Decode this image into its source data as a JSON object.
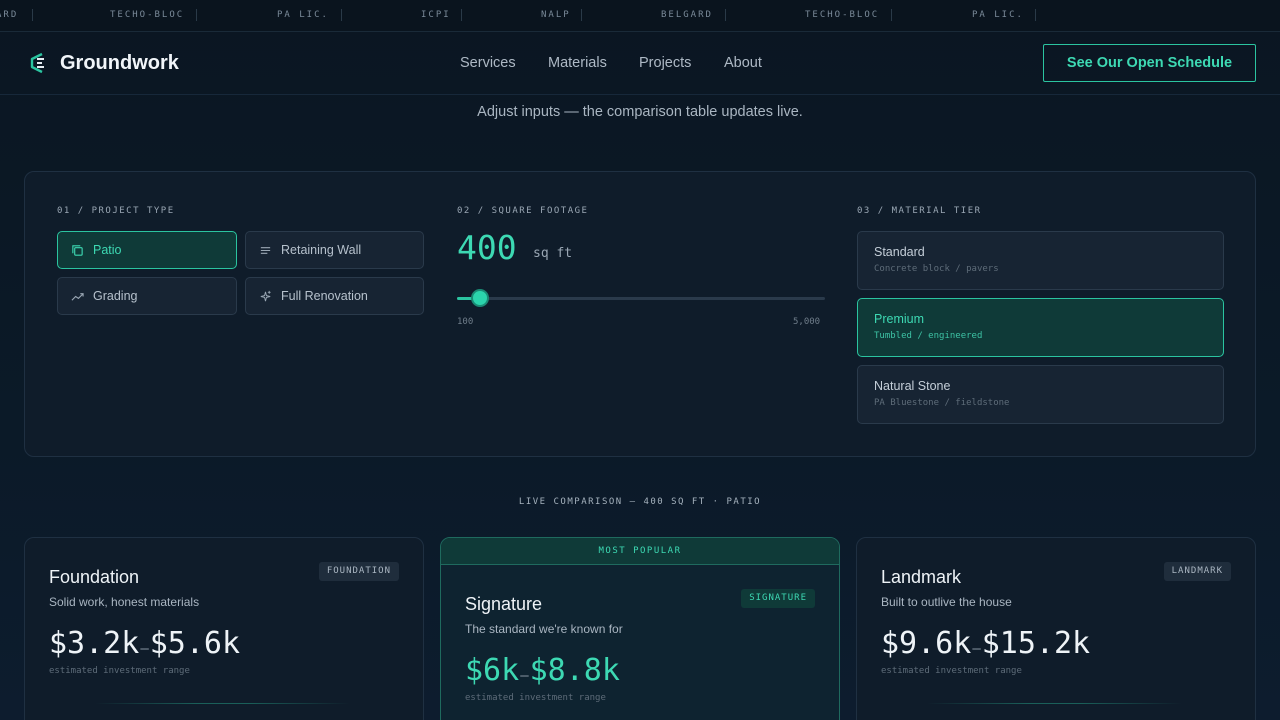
{
  "ticker": [
    "ARD",
    "TECHO-BLOC",
    "PA LIC.",
    "ICPI",
    "NALP",
    "BELGARD",
    "TECHO-BLOC",
    "PA LIC."
  ],
  "brand": {
    "name": "Groundwork",
    "icon": "groundwork-logo-icon"
  },
  "nav": [
    "Services",
    "Materials",
    "Projects",
    "About"
  ],
  "cta_label": "See Our Open Schedule",
  "subtitle": "Adjust inputs — the comparison table updates live.",
  "config": {
    "project_type": {
      "label": "01 / PROJECT TYPE",
      "options": [
        {
          "label": "Patio",
          "icon": "copy-icon",
          "selected": true
        },
        {
          "label": "Retaining Wall",
          "icon": "lines-icon",
          "selected": false
        },
        {
          "label": "Grading",
          "icon": "trend-icon",
          "selected": false
        },
        {
          "label": "Full Renovation",
          "icon": "sparkle-icon",
          "selected": false
        }
      ]
    },
    "square_footage": {
      "label": "02 / SQUARE FOOTAGE",
      "value": "400",
      "unit": "sq ft",
      "min_label": "100",
      "max_label": "5,000",
      "min": 100,
      "max": 5000,
      "current": 400
    },
    "material_tier": {
      "label": "03 / MATERIAL TIER",
      "options": [
        {
          "name": "Standard",
          "desc": "Concrete block / pavers",
          "selected": false
        },
        {
          "name": "Premium",
          "desc": "Tumbled / engineered",
          "selected": true
        },
        {
          "name": "Natural Stone",
          "desc": "PA Bluestone / fieldstone",
          "selected": false
        }
      ]
    }
  },
  "comparison_label": "LIVE COMPARISON — 400 SQ FT · PATIO",
  "cards": [
    {
      "title": "Foundation",
      "tag": "FOUNDATION",
      "desc": "Solid work, honest materials",
      "price_low": "$3.2k",
      "price_high": "$5.6k",
      "note": "estimated investment range",
      "featured": false
    },
    {
      "title": "Signature",
      "tag": "SIGNATURE",
      "desc": "The standard we're known for",
      "price_low": "$6k",
      "price_high": "$8.8k",
      "note": "estimated investment range",
      "featured": true,
      "ribbon": "MOST POPULAR"
    },
    {
      "title": "Landmark",
      "tag": "LANDMARK",
      "desc": "Built to outlive the house",
      "price_low": "$9.6k",
      "price_high": "$15.2k",
      "note": "estimated investment range",
      "featured": false
    }
  ],
  "colors": {
    "accent": "#2bc4a0",
    "background": "#0b1622",
    "panel": "#0f1c2a"
  }
}
